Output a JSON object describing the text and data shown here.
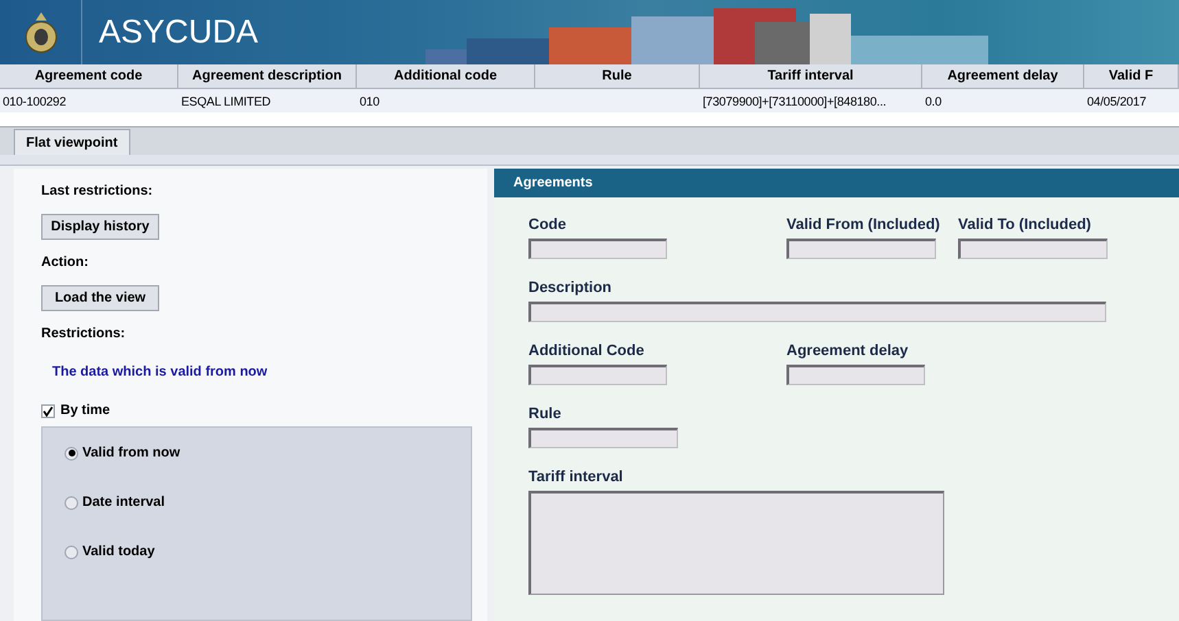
{
  "app": {
    "title": "ASYCUDA"
  },
  "table": {
    "columns": [
      "Agreement code",
      "Agreement description",
      "Additional code",
      "Rule",
      "Tariff interval",
      "Agreement delay",
      "Valid F"
    ],
    "rows": [
      {
        "cells": [
          "010-100292",
          "ESQAL LIMITED",
          "010",
          "",
          "[73079900]+[73110000]+[848180...",
          "0.0",
          "04/05/2017"
        ]
      }
    ]
  },
  "tabs": [
    {
      "label": "Flat viewpoint",
      "selected": true
    }
  ],
  "left_panel": {
    "last_restrictions_label": "Last restrictions:",
    "history_button": "Display history",
    "action_label": "Action:",
    "load_button": "Load the view",
    "restrictions_label": "Restrictions:",
    "restriction_summary": "The data which is valid from now",
    "by_time": {
      "label": "By time",
      "checked": true
    },
    "options": [
      {
        "label": "Valid from now",
        "selected": true
      },
      {
        "label": "Date interval",
        "selected": false
      },
      {
        "label": "Valid today",
        "selected": false
      }
    ]
  },
  "form": {
    "title": "Agreements",
    "fields": [
      {
        "label": "Code",
        "kind": "short"
      },
      {
        "label": "Valid From (Included)",
        "kind": "short"
      },
      {
        "label": "Valid To (Included)",
        "kind": "short"
      },
      {
        "label": "Description",
        "kind": "wide"
      },
      {
        "label": "Additional Code",
        "kind": "short"
      },
      {
        "label": "Agreement delay",
        "kind": "short"
      },
      {
        "label": "Rule",
        "kind": "short"
      },
      {
        "label": "Tariff interval",
        "kind": "area"
      }
    ]
  }
}
